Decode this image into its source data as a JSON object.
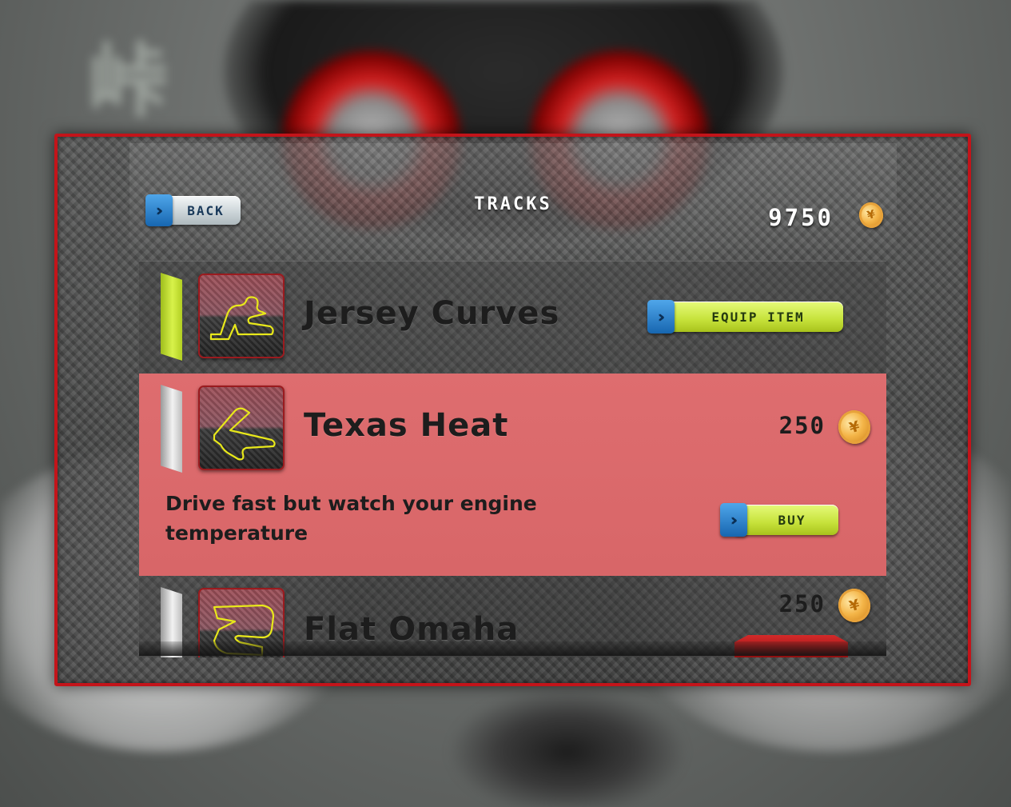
{
  "header": {
    "back_label": "BACK",
    "title": "TRACKS",
    "balance": "9750",
    "currency_icon": "coin-icon"
  },
  "tracks": [
    {
      "name": "Jersey Curves",
      "status": "owned",
      "action_label": "EQUIP ITEM",
      "marker_color": "#c9e22e",
      "icon": "track-map-icon"
    },
    {
      "name": "Texas Heat",
      "status": "selected",
      "price": "250",
      "description": "Drive fast but watch your engine temperature",
      "action_label": "BUY",
      "marker_color": "#e8e8e8",
      "icon": "track-map-icon"
    },
    {
      "name": "Flat Omaha",
      "status": "locked",
      "price": "250",
      "marker_color": "#e8e8e8",
      "icon": "track-map-icon"
    }
  ],
  "colors": {
    "frame_red": "#c3141a",
    "selected_row": "#dc6a6c",
    "button_green": "#c6e23a",
    "button_blue": "#1f7ac4",
    "track_line": "#e8e81a"
  }
}
